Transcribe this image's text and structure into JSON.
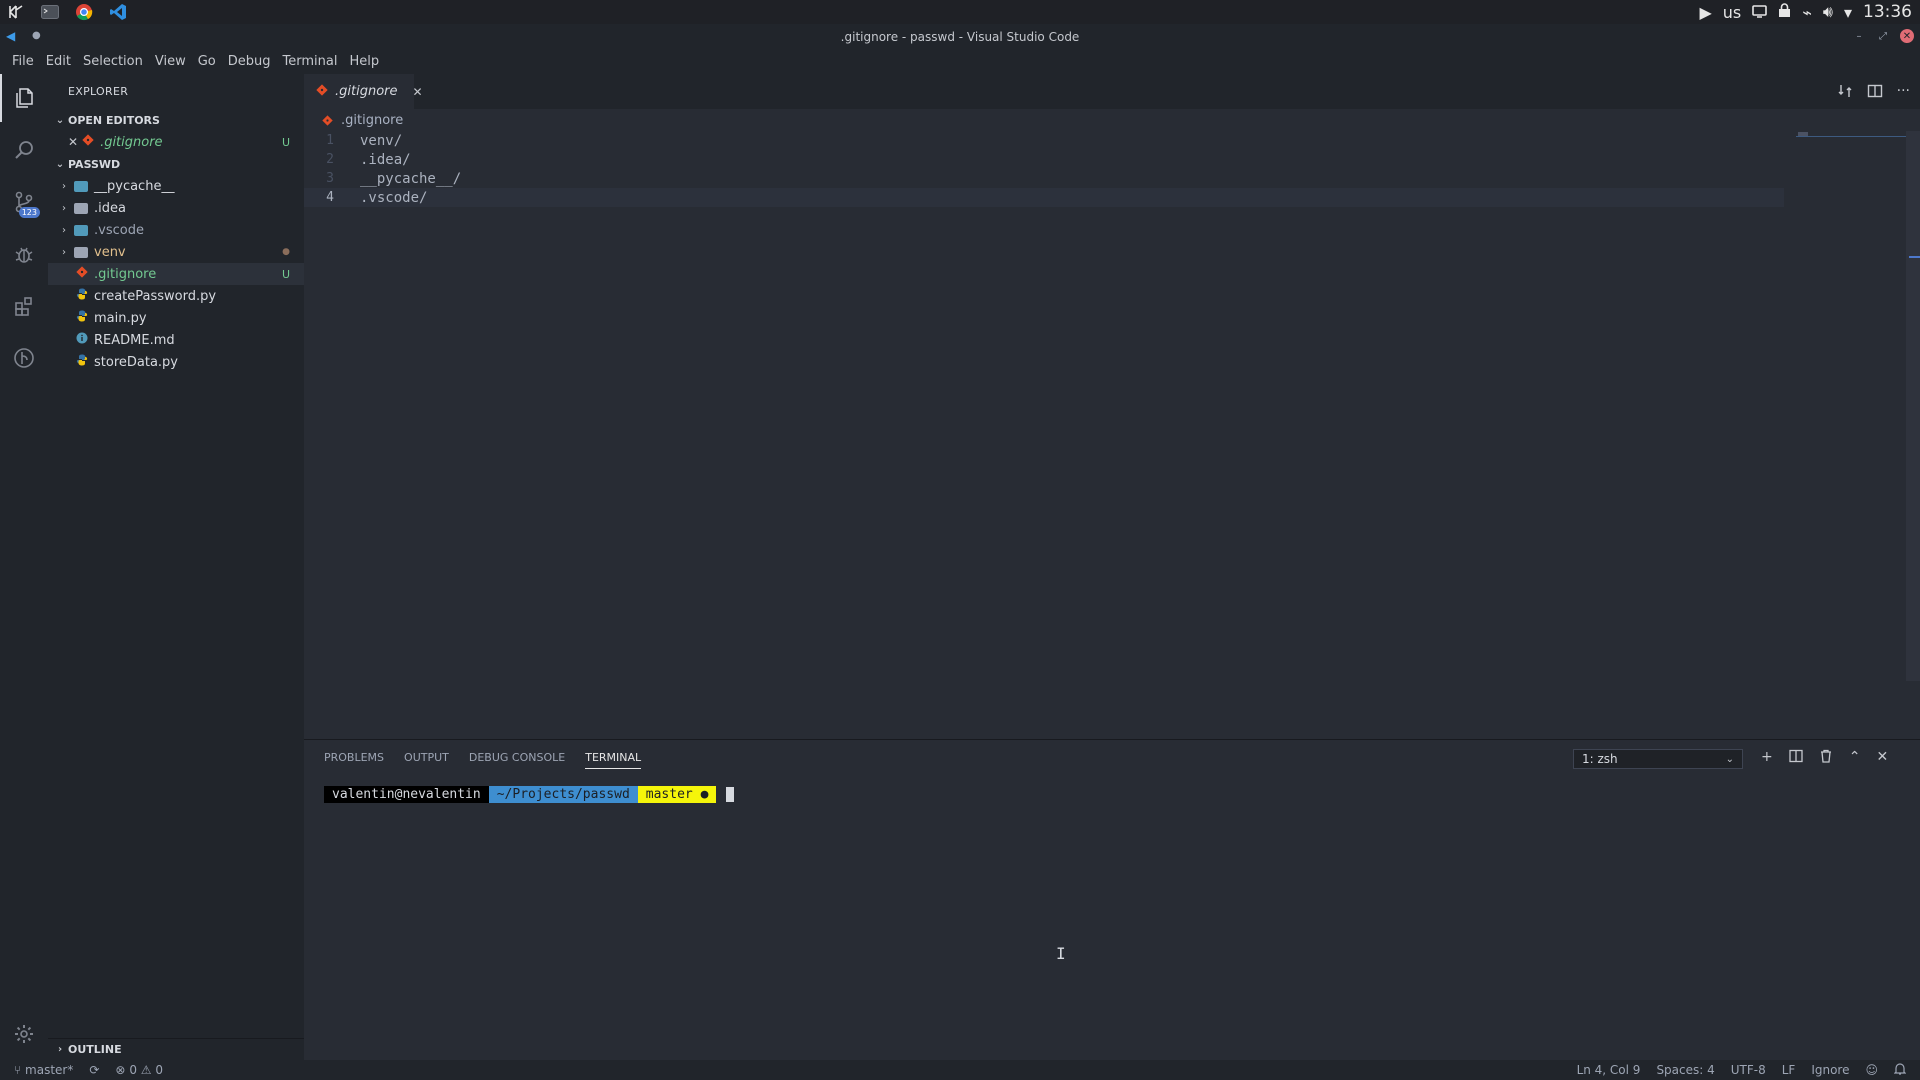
{
  "system_bar": {
    "keyboard_layout": "us",
    "clock": "13:36"
  },
  "window": {
    "title": ".gitignore - passwd - Visual Studio Code"
  },
  "menu": [
    "File",
    "Edit",
    "Selection",
    "View",
    "Go",
    "Debug",
    "Terminal",
    "Help"
  ],
  "activity": {
    "scm_badge": "123"
  },
  "sidebar": {
    "title": "EXPLORER",
    "open_editors_label": "OPEN EDITORS",
    "open_editor": {
      "name": ".gitignore",
      "status": "U"
    },
    "project_label": "PASSWD",
    "items": [
      {
        "name": "__pycache__",
        "type": "folder",
        "folder_color": "#519aba"
      },
      {
        "name": ".idea",
        "type": "folder",
        "folder_color": "#9da5b4"
      },
      {
        "name": ".vscode",
        "type": "folder",
        "folder_color": "#519aba"
      },
      {
        "name": "venv",
        "type": "folder",
        "folder_color": "#9da5b4",
        "status": "●"
      },
      {
        "name": ".gitignore",
        "type": "git",
        "status": "U"
      },
      {
        "name": "createPassword.py",
        "type": "python"
      },
      {
        "name": "main.py",
        "type": "python"
      },
      {
        "name": "README.md",
        "type": "info"
      },
      {
        "name": "storeData.py",
        "type": "python"
      }
    ],
    "outline_label": "OUTLINE"
  },
  "editor": {
    "tab": ".gitignore",
    "breadcrumb": ".gitignore",
    "lines": [
      {
        "num": "1",
        "text": "venv/"
      },
      {
        "num": "2",
        "text": ".idea/"
      },
      {
        "num": "3",
        "text": "__pycache__/"
      },
      {
        "num": "4",
        "text": ".vscode/"
      }
    ]
  },
  "panel": {
    "tabs": [
      "PROBLEMS",
      "OUTPUT",
      "DEBUG CONSOLE",
      "TERMINAL"
    ],
    "terminal_select": "1: zsh",
    "prompt_user": "valentin@nevalentin",
    "prompt_path": "~/Projects/passwd",
    "prompt_git": "master ●"
  },
  "status": {
    "branch": "master*",
    "errors": "0",
    "warnings": "0",
    "position": "Ln 4, Col 9",
    "spaces": "Spaces: 4",
    "encoding": "UTF-8",
    "eol": "LF",
    "language": "Ignore"
  },
  "colors": {
    "git_orange": "#e44d26",
    "untracked_green": "#73c991",
    "python_yellow": "#f1c40f",
    "accent_blue": "#4d78cc"
  }
}
